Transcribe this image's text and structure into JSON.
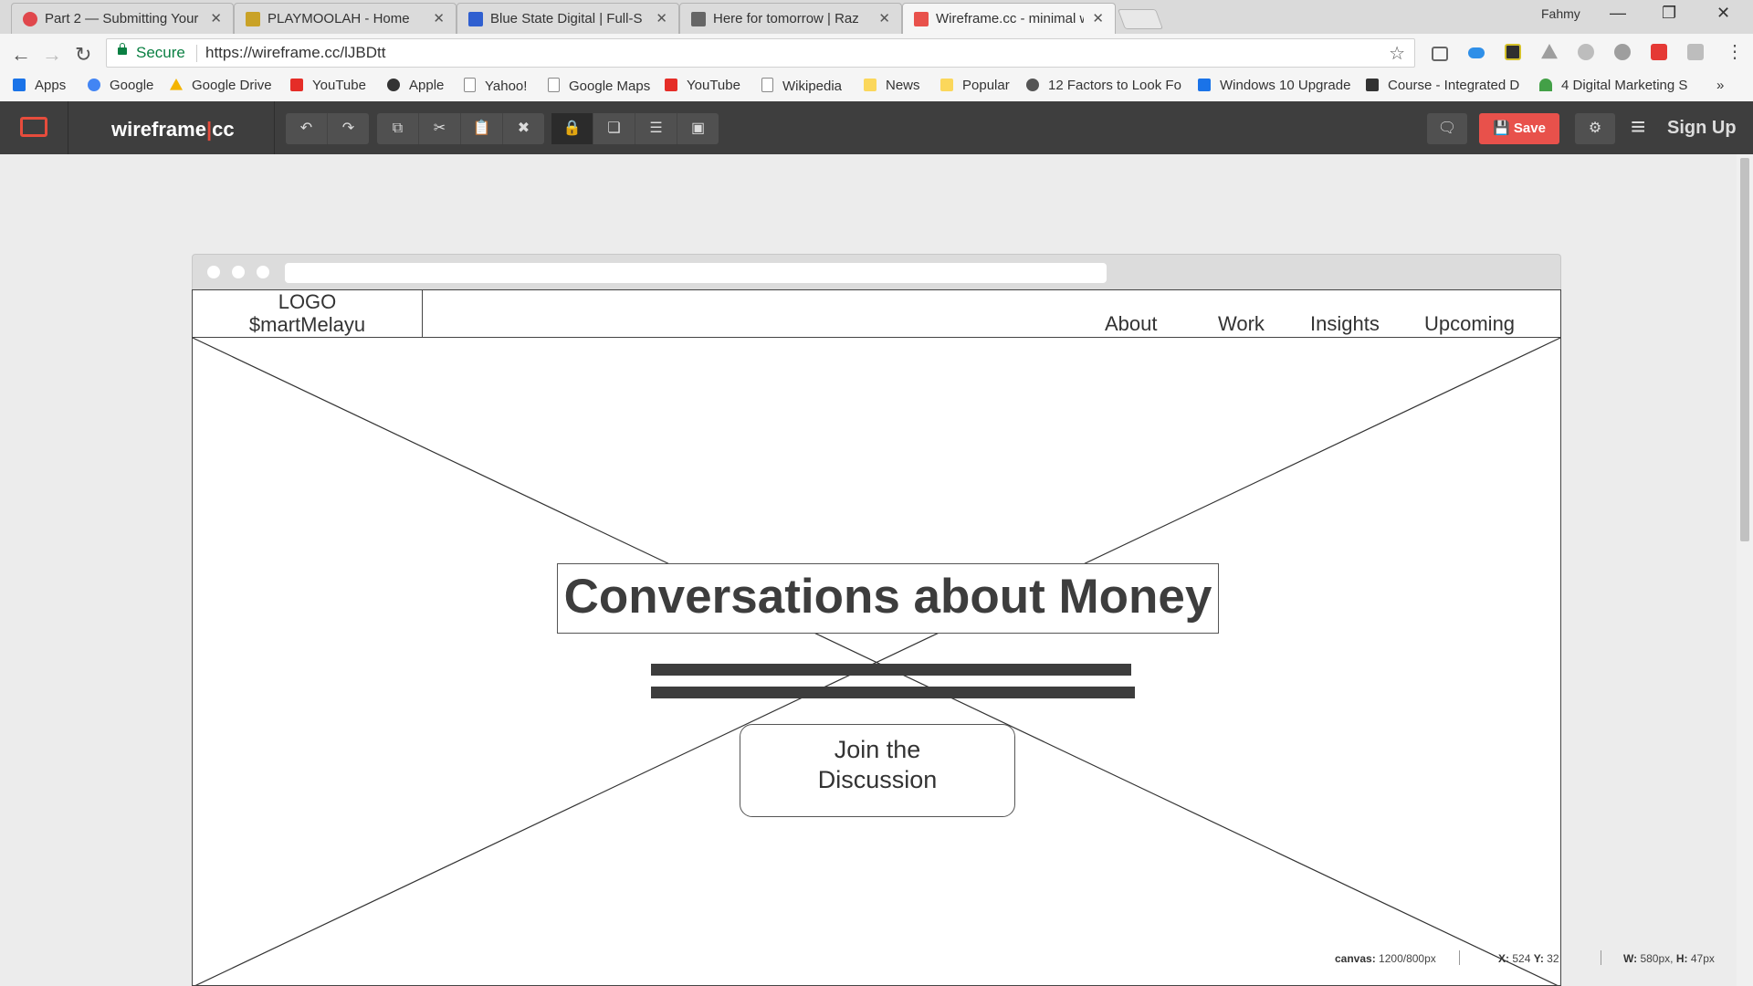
{
  "browser": {
    "tabs": [
      {
        "title": "Part 2 — Submitting Your",
        "icon": "ga-icon",
        "icon_color": "#e0474c"
      },
      {
        "title": "PLAYMOOLAH - Home",
        "icon": "playmoolah-icon",
        "icon_color": "#c9a227"
      },
      {
        "title": "Blue State Digital | Full-S",
        "icon": "bsd-icon",
        "icon_color": "#2f5fd0"
      },
      {
        "title": "Here for tomorrow | Raz",
        "icon": "razor-icon",
        "icon_color": "#666666"
      },
      {
        "title": "Wireframe.cc - minimal w",
        "icon": "wireframe-icon",
        "icon_color": "#e8514b",
        "active": true
      }
    ],
    "close_glyph": "✕",
    "user_name": "Fahmy",
    "window_controls": {
      "minimize": "—",
      "maximize": "❐",
      "close": "✕"
    },
    "nav": {
      "back": "←",
      "forward": "→",
      "reload": "↻"
    },
    "secure_label": "Secure",
    "url": "https://wireframe.cc/lJBDtt",
    "bookmark_star": "☆",
    "extensions": [
      {
        "name": "cast-icon",
        "color": "#666666"
      },
      {
        "name": "cloud-icon",
        "color": "#2f8fe8"
      },
      {
        "name": "check-extension-icon",
        "color": "#2f2f2f"
      },
      {
        "name": "drive-extension-icon",
        "color": "#9e9e9e"
      },
      {
        "name": "lastpass-icon",
        "color": "#9e9e9e"
      },
      {
        "name": "ghostery-icon",
        "color": "#9e9e9e"
      },
      {
        "name": "s-extension-icon",
        "color": "#e53935"
      },
      {
        "name": "pdf-extension-icon",
        "color": "#bdbdbd"
      }
    ],
    "menu_glyph": "⋮",
    "bookmarks": [
      {
        "label": "Apps",
        "icon": "apps-grid-icon",
        "color": "#1a73e8"
      },
      {
        "label": "Google",
        "icon": "google-icon",
        "color": "#4285f4"
      },
      {
        "label": "Google Drive",
        "icon": "drive-icon",
        "color": "#f4b400"
      },
      {
        "label": "YouTube",
        "icon": "youtube-icon",
        "color": "#e52d27"
      },
      {
        "label": "Apple",
        "icon": "apple-icon",
        "color": "#333333"
      },
      {
        "label": "Yahoo!",
        "icon": "page-icon",
        "color": "#ffffff"
      },
      {
        "label": "Google Maps",
        "icon": "page-icon",
        "color": "#ffffff"
      },
      {
        "label": "YouTube",
        "icon": "youtube-icon",
        "color": "#e52d27"
      },
      {
        "label": "Wikipedia",
        "icon": "page-icon",
        "color": "#ffffff"
      },
      {
        "label": "News",
        "icon": "folder-icon",
        "color": "#fbd75b"
      },
      {
        "label": "Popular",
        "icon": "folder-icon",
        "color": "#fbd75b"
      },
      {
        "label": "12 Factors to Look Fo",
        "icon": "site-icon",
        "color": "#555555"
      },
      {
        "label": "Windows 10 Upgrade",
        "icon": "site-icon",
        "color": "#1a73e8"
      },
      {
        "label": "Course - Integrated D",
        "icon": "site-icon",
        "color": "#333333"
      },
      {
        "label": "4 Digital Marketing S",
        "icon": "wifi-icon",
        "color": "#43a047"
      }
    ],
    "bookmarks_more": "»"
  },
  "app": {
    "brand_left": "wireframe",
    "brand_sep": "|",
    "brand_right": "cc",
    "toolbar": {
      "undo": "↶",
      "redo": "↷",
      "copy": "⧉",
      "cut": "✂",
      "paste": "📋",
      "delete": "✖",
      "lock": "🔒",
      "arrange": "❏",
      "align": "☰",
      "group": "▣"
    },
    "comment_glyph": "🗨",
    "save_label": "Save",
    "save_glyph": "💾",
    "settings_glyph": "⚙",
    "hamburger_glyph": "≡",
    "signup_label": "Sign Up",
    "colors": {
      "accent": "#e8514b",
      "toolbar": "#3e3e3e"
    }
  },
  "wireframe": {
    "logo_line1": "LOGO",
    "logo_line2": "$martMelayu",
    "nav": [
      "About",
      "Work",
      "Insights",
      "Upcoming"
    ],
    "headline": "Conversations about Money",
    "button_line1": "Join the",
    "button_line2": "Discussion"
  },
  "status": {
    "canvas_label": "canvas:",
    "canvas_value": "1200/800px",
    "x_label": "X:",
    "x_value": "524",
    "y_label": "Y:",
    "y_value": "32",
    "w_label": "W:",
    "w_value": "580px,",
    "h_label": "H:",
    "h_value": "47px"
  }
}
